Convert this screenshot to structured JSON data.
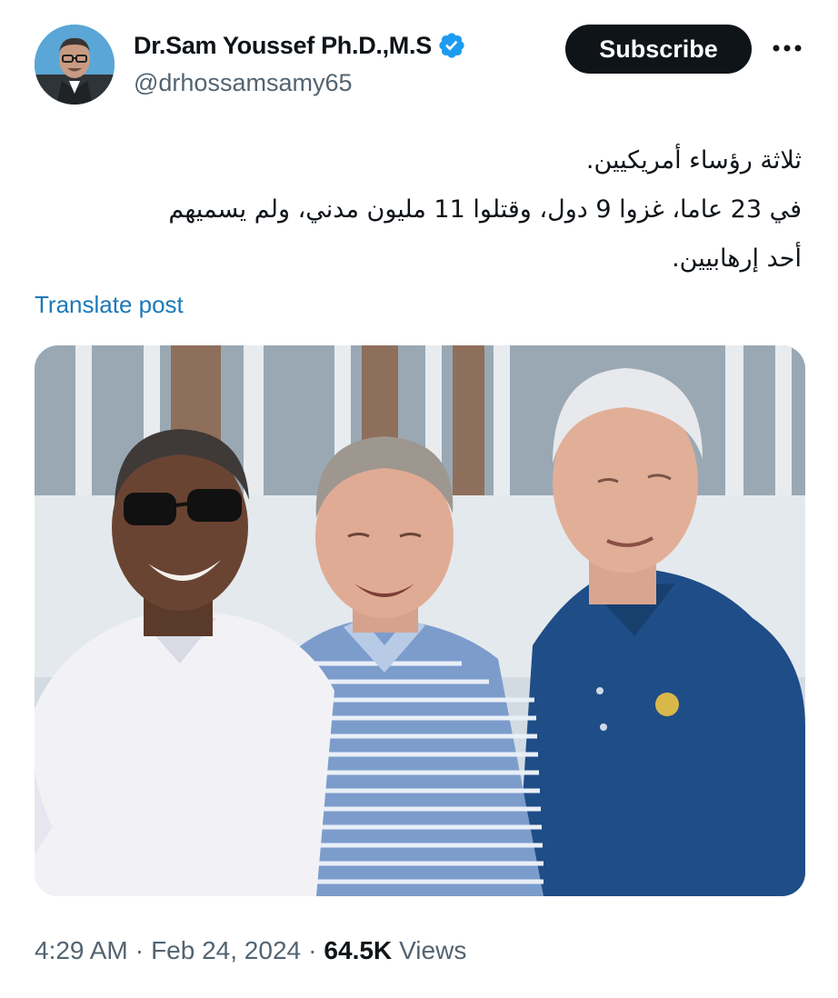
{
  "author": {
    "display_name": "Dr.Sam Youssef Ph.D.,M.S",
    "handle": "@drhossamsamy65",
    "verified": true,
    "verified_color": "#1d9bf0"
  },
  "header": {
    "subscribe_label": "Subscribe",
    "more_icon": "more-dots-icon"
  },
  "post": {
    "lines": [
      "ثلاثة رؤساء أمريكيين.",
      "في 23 عاما، غزوا 9 دول، وقتلوا 11 مليون مدني، ولم يسميهم",
      "أحد إرهابيين."
    ],
    "translate_label": "Translate post"
  },
  "meta": {
    "time": "4:29 AM",
    "separator": "·",
    "date": "Feb 24, 2024",
    "views_count": "64.5K",
    "views_label": "Views"
  },
  "colors": {
    "text": "#0f1419",
    "secondary": "#536471",
    "link": "#1d79b8",
    "button_bg": "#0f1419"
  }
}
